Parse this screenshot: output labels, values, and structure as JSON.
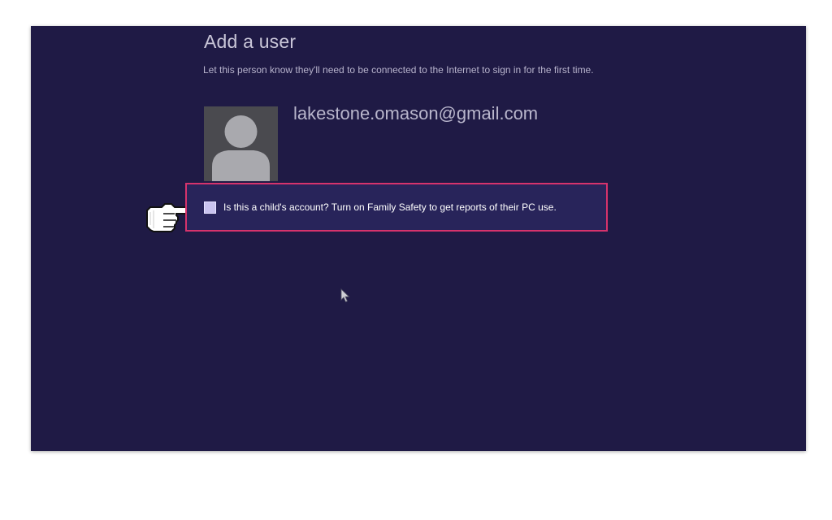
{
  "dialog": {
    "title": "Add a user",
    "subtitle": "Let this person know they'll need to be connected to the Internet to sign in for the first time.",
    "email": "lakestone.omason@gmail.com",
    "child_account_label": "Is this a child's account? Turn on Family Safety to get reports of their PC use.",
    "child_account_checked": false
  },
  "icons": {
    "avatar": "user-silhouette-icon",
    "pointer": "hand-pointer-icon",
    "cursor": "mouse-cursor-icon"
  },
  "colors": {
    "background": "#1f1a45",
    "highlight_border": "#d6336c",
    "checkbox": "#c9c3ef"
  }
}
